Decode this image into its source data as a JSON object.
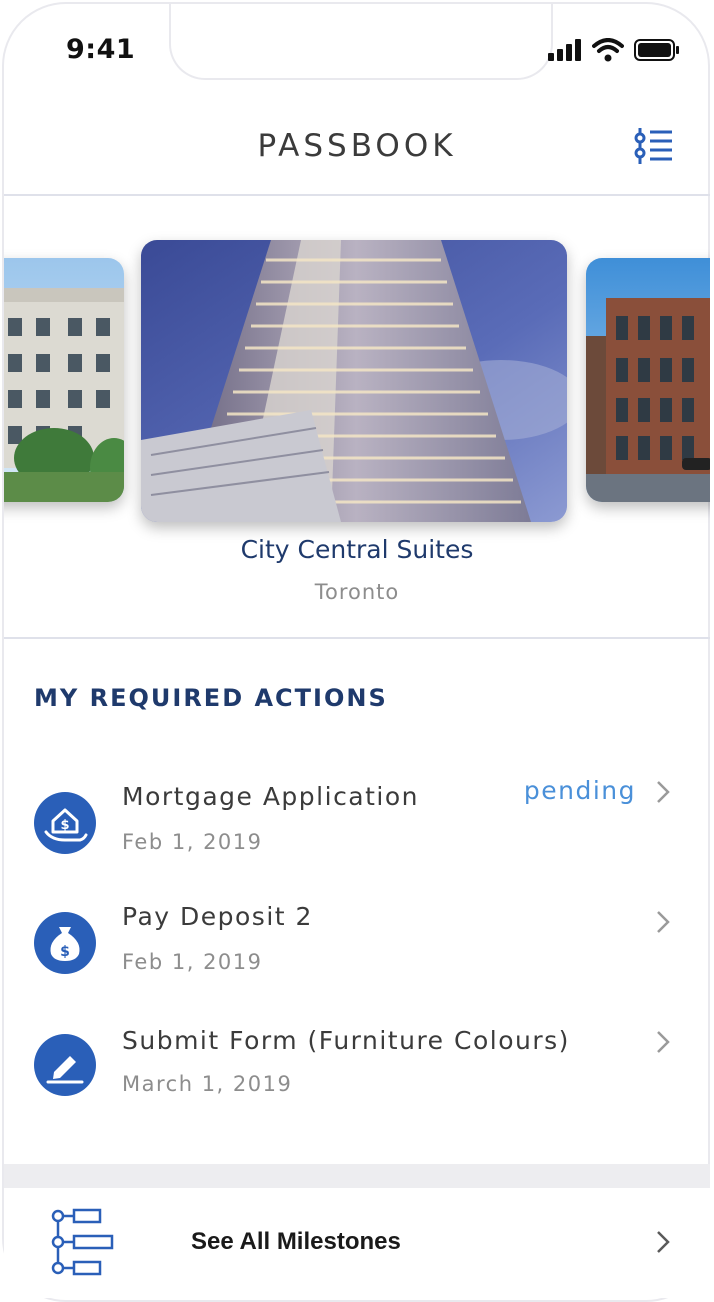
{
  "status_bar": {
    "time": "9:41"
  },
  "header": {
    "title": "PASSBOOK"
  },
  "project": {
    "name": "City Central Suites",
    "city": "Toronto"
  },
  "actions_section": {
    "title": "MY REQUIRED ACTIONS",
    "items": [
      {
        "title": "Mortgage Application",
        "date": "Feb 1, 2019",
        "status": "pending",
        "icon": "house-dollar-hand-icon"
      },
      {
        "title": "Pay Deposit 2",
        "date": "Feb 1, 2019",
        "status": "",
        "icon": "money-bag-icon"
      },
      {
        "title": "Submit Form (Furniture Colours)",
        "date": "March 1, 2019",
        "status": "",
        "icon": "pencil-icon"
      }
    ]
  },
  "footer": {
    "milestones_label": "See All Milestones"
  },
  "colors": {
    "primary": "#2a5fb8",
    "navy": "#1f3a6c",
    "status": "#4a90d9"
  }
}
